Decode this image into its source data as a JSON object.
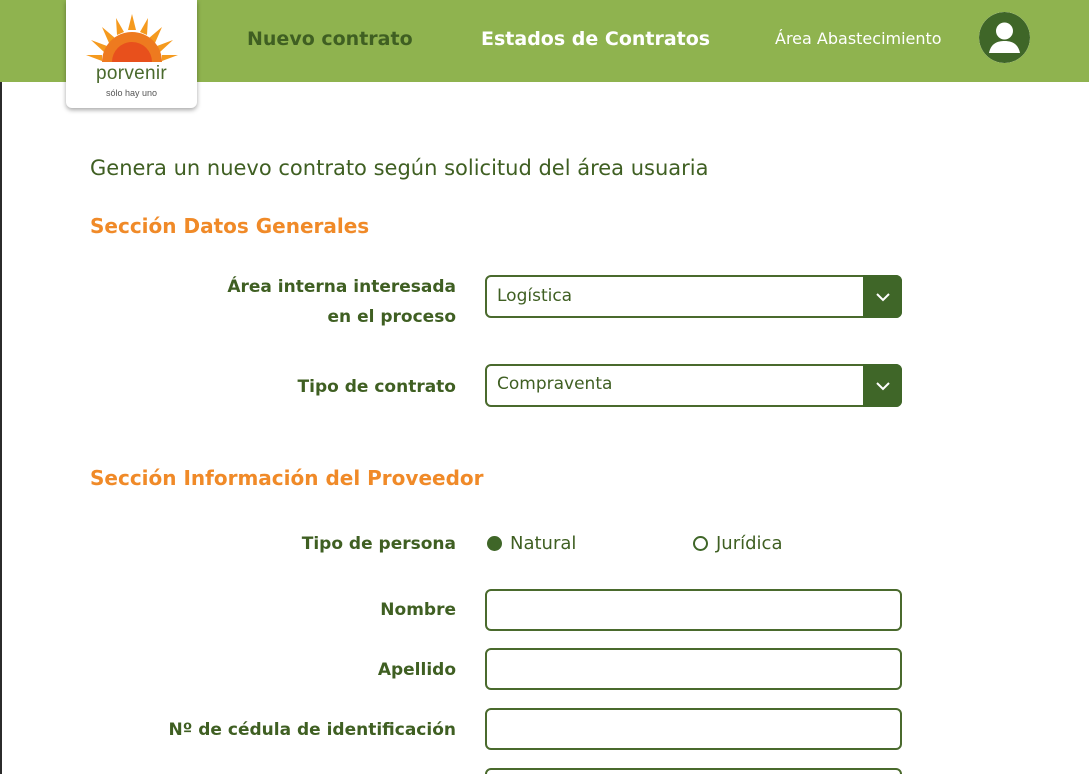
{
  "header": {
    "logo_name": "porvenir",
    "logo_tagline": "sólo hay uno",
    "nav_new": "Nuevo contrato",
    "nav_states": "Estados de Contratos",
    "area": "Área Abastecimiento",
    "avatar_icon": "user-icon"
  },
  "intro": "Genera un nuevo contrato según solicitud del área usuaria",
  "general": {
    "title": "Sección Datos Generales",
    "area_label_1": "Área interna interesada",
    "area_label_2": "en el proceso",
    "area_value": "Logística",
    "type_label": "Tipo de contrato",
    "type_value": "Compraventa"
  },
  "provider": {
    "title": "Sección Información del Proveedor",
    "person_label": "Tipo de persona",
    "options": [
      "Natural",
      "Jurídica"
    ],
    "selected": "Natural",
    "name_label": "Nombre",
    "surname_label": "Apellido",
    "id_label": "Nº de cédula de identificación"
  },
  "colors": {
    "header_green": "#8fb34f",
    "dark_green": "#3f6628",
    "section_orange": "#f08a28",
    "text_green": "#3f5f22"
  }
}
